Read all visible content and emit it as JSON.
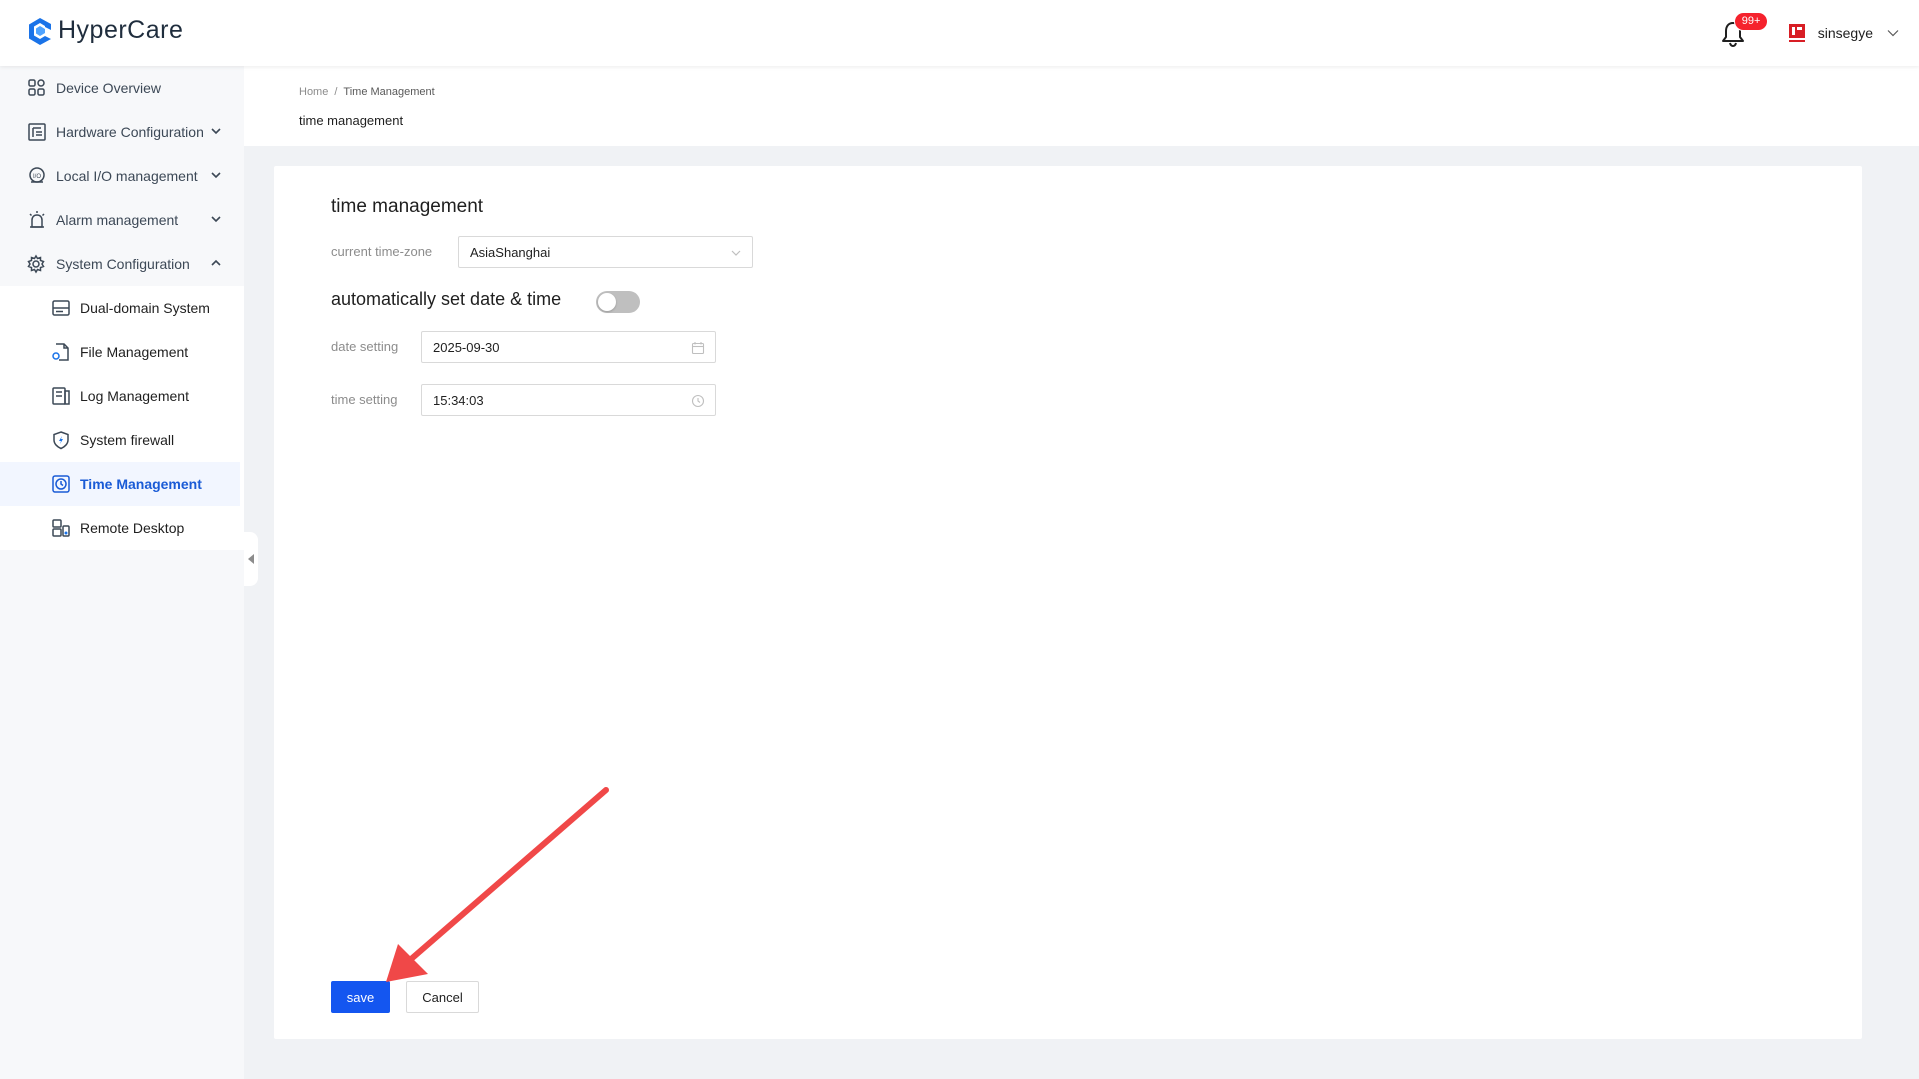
{
  "app": {
    "name": "HyperCare"
  },
  "header": {
    "notification_count": "99+",
    "username": "sinsegye"
  },
  "sidebar": {
    "items": [
      {
        "label": "Device Overview",
        "icon": "dashboard-grid-icon"
      },
      {
        "label": "Hardware Configuration",
        "icon": "hardware-config-icon",
        "expandable": true
      },
      {
        "label": "Local I/O management",
        "icon": "io-management-icon",
        "expandable": true
      },
      {
        "label": "Alarm management",
        "icon": "alarm-icon",
        "expandable": true
      },
      {
        "label": "System Configuration",
        "icon": "system-config-icon",
        "expanded": true
      }
    ],
    "subitems": [
      {
        "label": "Dual-domain System",
        "icon": "server-icon"
      },
      {
        "label": "File Management",
        "icon": "file-settings-icon"
      },
      {
        "label": "Log Management",
        "icon": "log-icon"
      },
      {
        "label": "System firewall",
        "icon": "shield-icon"
      },
      {
        "label": "Time Management",
        "icon": "clock-icon",
        "active": true
      },
      {
        "label": "Remote Desktop",
        "icon": "remote-desktop-icon"
      }
    ]
  },
  "breadcrumb": {
    "home": "Home",
    "separator": "/",
    "current": "Time Management"
  },
  "page_title": "time management",
  "form": {
    "section_title": "time management",
    "timezone_label": "current time-zone",
    "timezone_value": "AsiaShanghai",
    "auto_label": "automatically set date & time",
    "auto_enabled": false,
    "date_label": "date setting",
    "date_value": "2025-09-30",
    "time_label": "time setting",
    "time_value": "15:34:03"
  },
  "actions": {
    "save": "save",
    "cancel": "Cancel"
  },
  "colors": {
    "primary": "#1456f0",
    "active_text": "#1a5bd6",
    "badge": "#f5222d",
    "arrow": "#f04848"
  }
}
